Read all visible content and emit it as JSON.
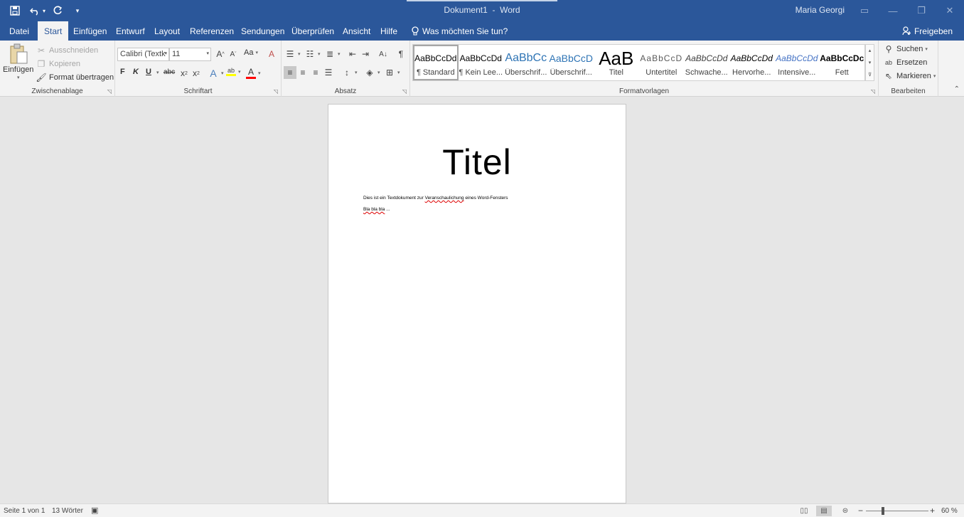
{
  "titlebar": {
    "document": "Dokument1",
    "separator": "-",
    "app": "Word",
    "user": "Maria Georgi"
  },
  "tabs": [
    {
      "label": "Datei",
      "active": false
    },
    {
      "label": "Start",
      "active": true
    },
    {
      "label": "Einfügen",
      "active": false
    },
    {
      "label": "Entwurf",
      "active": false
    },
    {
      "label": "Layout",
      "active": false
    },
    {
      "label": "Referenzen",
      "active": false
    },
    {
      "label": "Sendungen",
      "active": false
    },
    {
      "label": "Überprüfen",
      "active": false
    },
    {
      "label": "Ansicht",
      "active": false
    },
    {
      "label": "Hilfe",
      "active": false
    }
  ],
  "tellme": "Was möchten Sie tun?",
  "share": "Freigeben",
  "clipboard": {
    "paste": "Einfügen",
    "cut": "Ausschneiden",
    "copy": "Kopieren",
    "format_painter": "Format übertragen",
    "label": "Zwischenablage"
  },
  "font": {
    "family": "Calibri (Textk",
    "size": "11",
    "bold": "F",
    "italic": "K",
    "underline": "U",
    "strike": "abc",
    "change_case": "Aa",
    "label": "Schriftart",
    "highlight_color": "#ffff00",
    "font_color": "#ff0000"
  },
  "paragraph": {
    "label": "Absatz"
  },
  "styles": {
    "label": "Formatvorlagen",
    "items": [
      {
        "preview": "AaBbCcDd",
        "name": "¶ Standard"
      },
      {
        "preview": "AaBbCcDd",
        "name": "¶ Kein Lee..."
      },
      {
        "preview": "AaBbCc",
        "name": "Überschrif..."
      },
      {
        "preview": "AaBbCcD",
        "name": "Überschrif..."
      },
      {
        "preview": "AaB",
        "name": "Titel"
      },
      {
        "preview": "AaBbCcD",
        "name": "Untertitel"
      },
      {
        "preview": "AaBbCcDd",
        "name": "Schwache..."
      },
      {
        "preview": "AaBbCcDd",
        "name": "Hervorhe..."
      },
      {
        "preview": "AaBbCcDd",
        "name": "Intensive..."
      },
      {
        "preview": "AaBbCcDc",
        "name": "Fett"
      }
    ]
  },
  "editing": {
    "find": "Suchen",
    "replace": "Ersetzen",
    "select": "Markieren",
    "label": "Bearbeiten"
  },
  "document": {
    "title": "Titel",
    "line1_pre": "Dies ist ein Textdokument zur ",
    "line1_err": "Veranschaulichung",
    "line1_post": " eines Word-Fensters",
    "line2_err": "Bla bla bla",
    "line2_post": " ..."
  },
  "status": {
    "page": "Seite 1 von 1",
    "words": "13 Wörter",
    "zoom": "60 %",
    "zoom_level": 0.6
  },
  "colors": {
    "brand": "#2b579a"
  }
}
